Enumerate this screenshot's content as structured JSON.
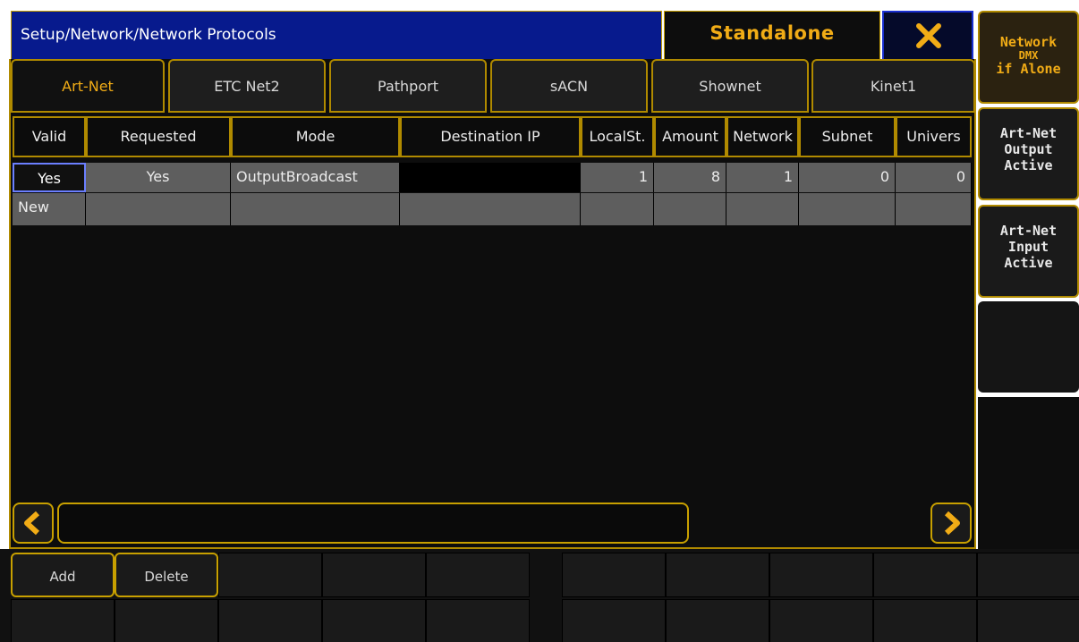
{
  "title_bar": {
    "path": "Setup/Network/Network Protocols",
    "mode_label": "Standalone",
    "close_icon": "close-x-icon"
  },
  "side_buttons": {
    "network_dmx": {
      "line1": "Network",
      "line2": "DMX",
      "line3": "if Alone"
    },
    "artnet_output": {
      "line1": "Art-Net",
      "line2": "Output",
      "line3": "Active"
    },
    "artnet_input": {
      "line1": "Art-Net",
      "line2": "Input",
      "line3": "Active"
    }
  },
  "tabs": [
    {
      "label": "Art-Net",
      "active": true
    },
    {
      "label": "ETC Net2"
    },
    {
      "label": "Pathport"
    },
    {
      "label": "sACN"
    },
    {
      "label": "Shownet"
    },
    {
      "label": "Kinet1"
    }
  ],
  "table": {
    "columns": [
      "Valid",
      "Requested",
      "Mode",
      "Destination IP",
      "LocalSt.",
      "Amount",
      "Network",
      "Subnet",
      "Univers"
    ],
    "rows": [
      {
        "valid": "Yes",
        "requested": "Yes",
        "mode": "OutputBroadcast",
        "destination_ip": "",
        "localst": "1",
        "amount": "8",
        "network": "1",
        "subnet": "0",
        "universe": "0"
      },
      {
        "valid": "New",
        "requested": "",
        "mode": "",
        "destination_ip": "",
        "localst": "",
        "amount": "",
        "network": "",
        "subnet": "",
        "universe": ""
      }
    ]
  },
  "scrollbar": {
    "left_icon": "chevron-left-icon",
    "right_icon": "chevron-right-icon"
  },
  "bottom_buttons": {
    "add": "Add",
    "delete": "Delete"
  },
  "colors": {
    "accent": "#f1ac16",
    "border": "#b08a00",
    "title_bg": "#071a8d"
  }
}
